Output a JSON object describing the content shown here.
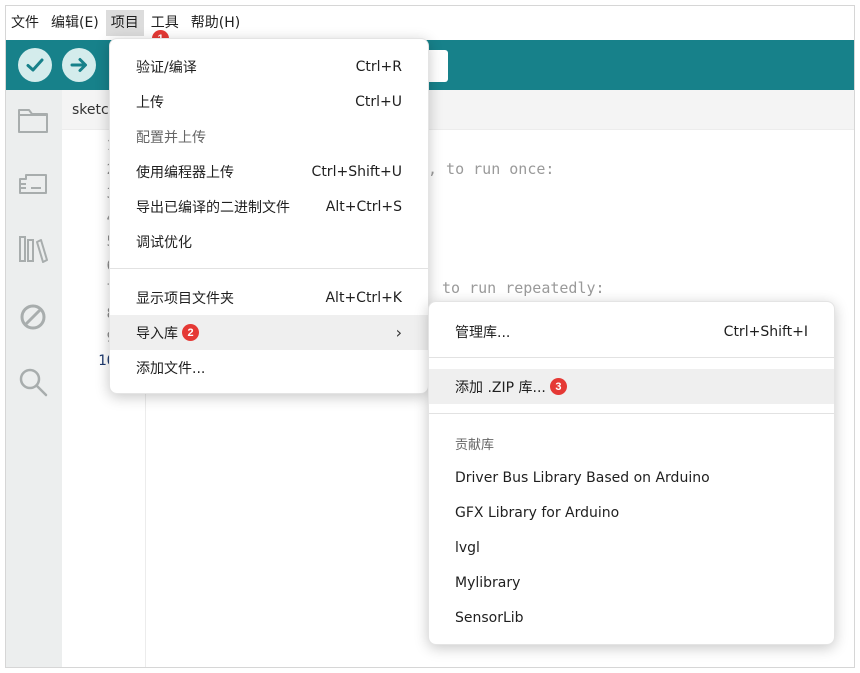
{
  "menubar": {
    "items": [
      {
        "label": "文件"
      },
      {
        "label": "编辑(E)"
      },
      {
        "label": "项目"
      },
      {
        "label": "工具"
      },
      {
        "label": "帮助(H)"
      }
    ]
  },
  "tab": {
    "label": "sketc"
  },
  "editor": {
    "line_numbers": [
      "1",
      "2",
      "3",
      "4",
      "5",
      "6",
      "7",
      "8",
      "9",
      "10"
    ],
    "code_fragments": [
      ", to run once:",
      "to run repeatedly:"
    ]
  },
  "project_menu": {
    "items": [
      {
        "label": "验证/编译",
        "shortcut": "Ctrl+R"
      },
      {
        "label": "上传",
        "shortcut": "Ctrl+U"
      },
      {
        "label": "配置并上传",
        "shortcut": ""
      },
      {
        "label": "使用编程器上传",
        "shortcut": "Ctrl+Shift+U"
      },
      {
        "label": "导出已编译的二进制文件",
        "shortcut": "Alt+Ctrl+S"
      },
      {
        "label": "调试优化",
        "shortcut": ""
      },
      {
        "label": "显示项目文件夹",
        "shortcut": "Alt+Ctrl+K"
      },
      {
        "label": "导入库",
        "shortcut": "›"
      },
      {
        "label": "添加文件...",
        "shortcut": ""
      }
    ]
  },
  "library_menu": {
    "manage": {
      "label": "管理库...",
      "shortcut": "Ctrl+Shift+I"
    },
    "add_zip": {
      "label": "添加 .ZIP 库..."
    },
    "contributed_header": "贡献库",
    "libraries": [
      {
        "label": "Driver Bus Library Based on Arduino"
      },
      {
        "label": "GFX Library for Arduino"
      },
      {
        "label": "lvgl"
      },
      {
        "label": "Mylibrary"
      },
      {
        "label": "SensorLib"
      }
    ]
  },
  "badges": {
    "one": "1",
    "two": "2",
    "three": "3"
  },
  "colors": {
    "toolbar": "#17818a",
    "badge": "#e53935",
    "sidebar": "#eceeee"
  }
}
